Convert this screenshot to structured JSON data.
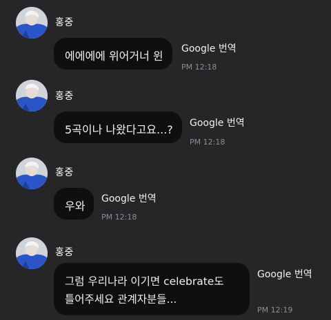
{
  "messages": [
    {
      "sender": "홍중",
      "lines": [
        "에에에에 위어거너 윈"
      ],
      "translate": "Google 번역",
      "time": "PM 12:18"
    },
    {
      "sender": "홍중",
      "lines": [
        "5곡이나 나왔다고요...?"
      ],
      "translate": "Google 번역",
      "time": "PM 12:18"
    },
    {
      "sender": "홍중",
      "lines": [
        "우와"
      ],
      "translate": "Google 번역",
      "time": "PM 12:18"
    },
    {
      "sender": "홍중",
      "lines": [
        "그럼 우리나라 이기면 celebrate도",
        "틀어주세요 관계자분들..."
      ],
      "translate": "Google 번역",
      "time": "PM 12:19"
    }
  ]
}
